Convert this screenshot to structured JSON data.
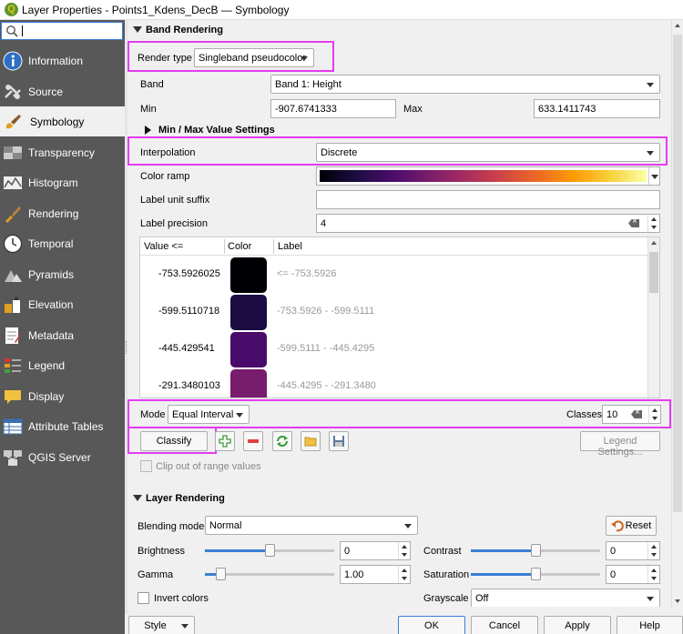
{
  "window": {
    "title": "Layer Properties - Points1_Kdens_DecB — Symbology"
  },
  "search": {
    "value": ""
  },
  "sidebar": {
    "items": [
      {
        "label": "Information",
        "icon": "info-icon"
      },
      {
        "label": "Source",
        "icon": "source-icon"
      },
      {
        "label": "Symbology",
        "icon": "symbology-brush-icon",
        "active": true
      },
      {
        "label": "Transparency",
        "icon": "transparency-icon"
      },
      {
        "label": "Histogram",
        "icon": "histogram-icon"
      },
      {
        "label": "Rendering",
        "icon": "rendering-brush-icon"
      },
      {
        "label": "Temporal",
        "icon": "clock-icon"
      },
      {
        "label": "Pyramids",
        "icon": "pyramids-icon"
      },
      {
        "label": "Elevation",
        "icon": "elevation-icon"
      },
      {
        "label": "Metadata",
        "icon": "metadata-icon"
      },
      {
        "label": "Legend",
        "icon": "legend-icon"
      },
      {
        "label": "Display",
        "icon": "display-speech-icon"
      },
      {
        "label": "Attribute Tables",
        "icon": "table-icon"
      },
      {
        "label": "QGIS Server",
        "icon": "server-icon"
      }
    ]
  },
  "band_rendering": {
    "title": "Band Rendering",
    "render_type_label": "Render type",
    "render_type_value": "Singleband pseudocolor",
    "band_label": "Band",
    "band_value": "Band 1: Height",
    "min_label": "Min",
    "min_value": "-907.6741333",
    "max_label": "Max",
    "max_value": "633.1411743",
    "minmax_title": "Min / Max Value Settings",
    "interpolation_label": "Interpolation",
    "interpolation_value": "Discrete",
    "color_ramp_label": "Color ramp",
    "label_unit_suffix_label": "Label unit suffix",
    "label_unit_suffix_value": "",
    "label_precision_label": "Label precision",
    "label_precision_value": "4",
    "table": {
      "headers": [
        "Value <=",
        "Color",
        "Label"
      ],
      "rows": [
        {
          "value": "-753.5926025",
          "color": "#000004",
          "label": "<= -753.5926"
        },
        {
          "value": "-599.5110718",
          "color": "#1b0c41",
          "label": "-753.5926 - -599.5111"
        },
        {
          "value": "-445.429541",
          "color": "#4a0c6b",
          "label": "-599.5111 - -445.4295"
        },
        {
          "value": "-291.3480103",
          "color": "#781c6d",
          "label": "-445.4295 - -291.3480"
        }
      ]
    },
    "mode_label": "Mode",
    "mode_value": "Equal Interval",
    "classes_label": "Classes",
    "classes_value": "10",
    "classify_label": "Classify",
    "legend_settings_label": "Legend Settings...",
    "clip_label": "Clip out of range values"
  },
  "layer_rendering": {
    "title": "Layer Rendering",
    "blending_label": "Blending mode",
    "blending_value": "Normal",
    "reset_label": "Reset",
    "brightness_label": "Brightness",
    "brightness_value": "0",
    "contrast_label": "Contrast",
    "contrast_value": "0",
    "gamma_label": "Gamma",
    "gamma_value": "1.00",
    "saturation_label": "Saturation",
    "saturation_value": "0",
    "invert_label": "Invert colors",
    "grayscale_label": "Grayscale",
    "grayscale_value": "Off"
  },
  "buttons": {
    "style": "Style",
    "ok": "OK",
    "cancel": "Cancel",
    "apply": "Apply",
    "help": "Help"
  },
  "colors": {
    "highlight": "#e33cf0",
    "sidebar_bg": "#585858",
    "accent": "#3a7fd5"
  }
}
